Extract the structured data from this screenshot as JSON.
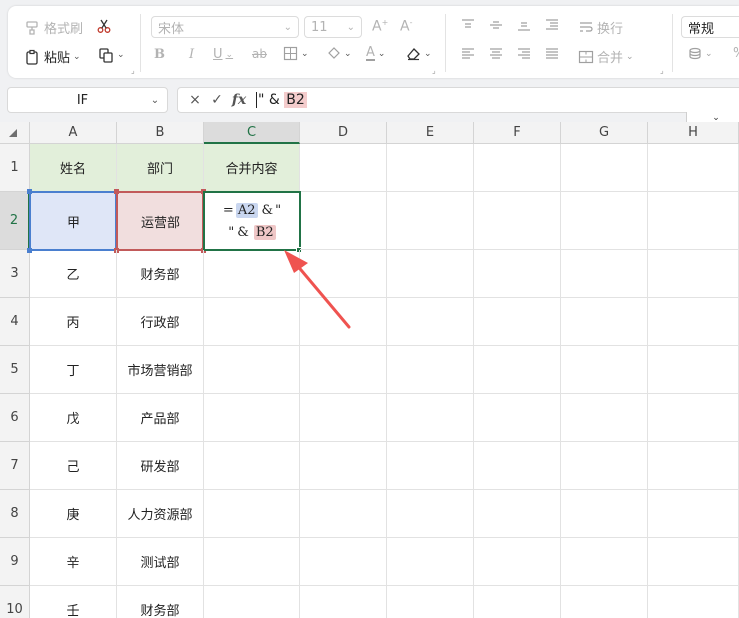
{
  "ribbon": {
    "format_painter": "格式刷",
    "paste": "粘贴",
    "font_name": "宋体",
    "font_size": "11",
    "wrap_text": "换行",
    "merge": "合并",
    "number_format": "常规"
  },
  "formula_bar": {
    "name_box": "IF",
    "cancel_icon": "×",
    "enter_icon": "✓",
    "fx_label": "fx",
    "formula_prefix": "\" & ",
    "formula_ref": "B2"
  },
  "columns": [
    "A",
    "B",
    "C",
    "D",
    "E",
    "F",
    "G",
    "H"
  ],
  "rows": [
    "1",
    "2",
    "3",
    "4",
    "5",
    "6",
    "7",
    "8",
    "9",
    "10"
  ],
  "headers": {
    "name": "姓名",
    "dept": "部门",
    "merge": "合并内容"
  },
  "data_rows": [
    {
      "name": "甲",
      "dept": "运营部"
    },
    {
      "name": "乙",
      "dept": "财务部"
    },
    {
      "name": "丙",
      "dept": "行政部"
    },
    {
      "name": "丁",
      "dept": "市场营销部"
    },
    {
      "name": "戊",
      "dept": "产品部"
    },
    {
      "name": "己",
      "dept": "研发部"
    },
    {
      "name": "庚",
      "dept": "人力资源部"
    },
    {
      "name": "辛",
      "dept": "测试部"
    },
    {
      "name": "壬",
      "dept": "财务部"
    }
  ],
  "editing_cell": {
    "eq": "=",
    "ref_a": "A2",
    "amp1": "&",
    "quote1": "\"",
    "quote2": "\"",
    "amp2": "&",
    "ref_b": "B2"
  },
  "colors": {
    "selected_green": "#217346",
    "ref_a_blue": "#4a7fcf",
    "ref_b_red": "#c25a5a",
    "arrow": "#ef5350",
    "header_fill": "#e2efda"
  }
}
